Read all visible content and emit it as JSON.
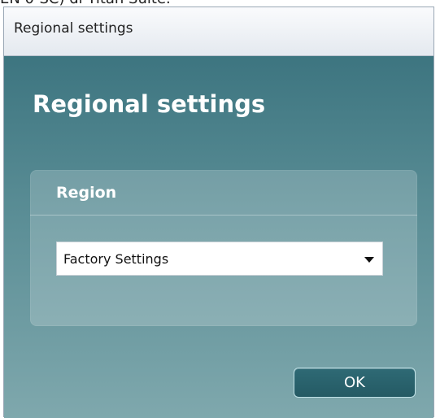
{
  "background_text": "EN 0-SC) di Titan Suite.",
  "window": {
    "title": "Regional settings"
  },
  "content": {
    "heading": "Regional settings",
    "region_panel": {
      "label": "Region",
      "select": {
        "value": "Factory Settings"
      }
    },
    "ok_button": {
      "label": "OK"
    }
  },
  "colors": {
    "teal_top": "#3d7580",
    "teal_bottom": "#7fa8ad",
    "button_teal": "#2f6a75"
  },
  "icons": {
    "dropdown": "chevron-down-icon"
  }
}
